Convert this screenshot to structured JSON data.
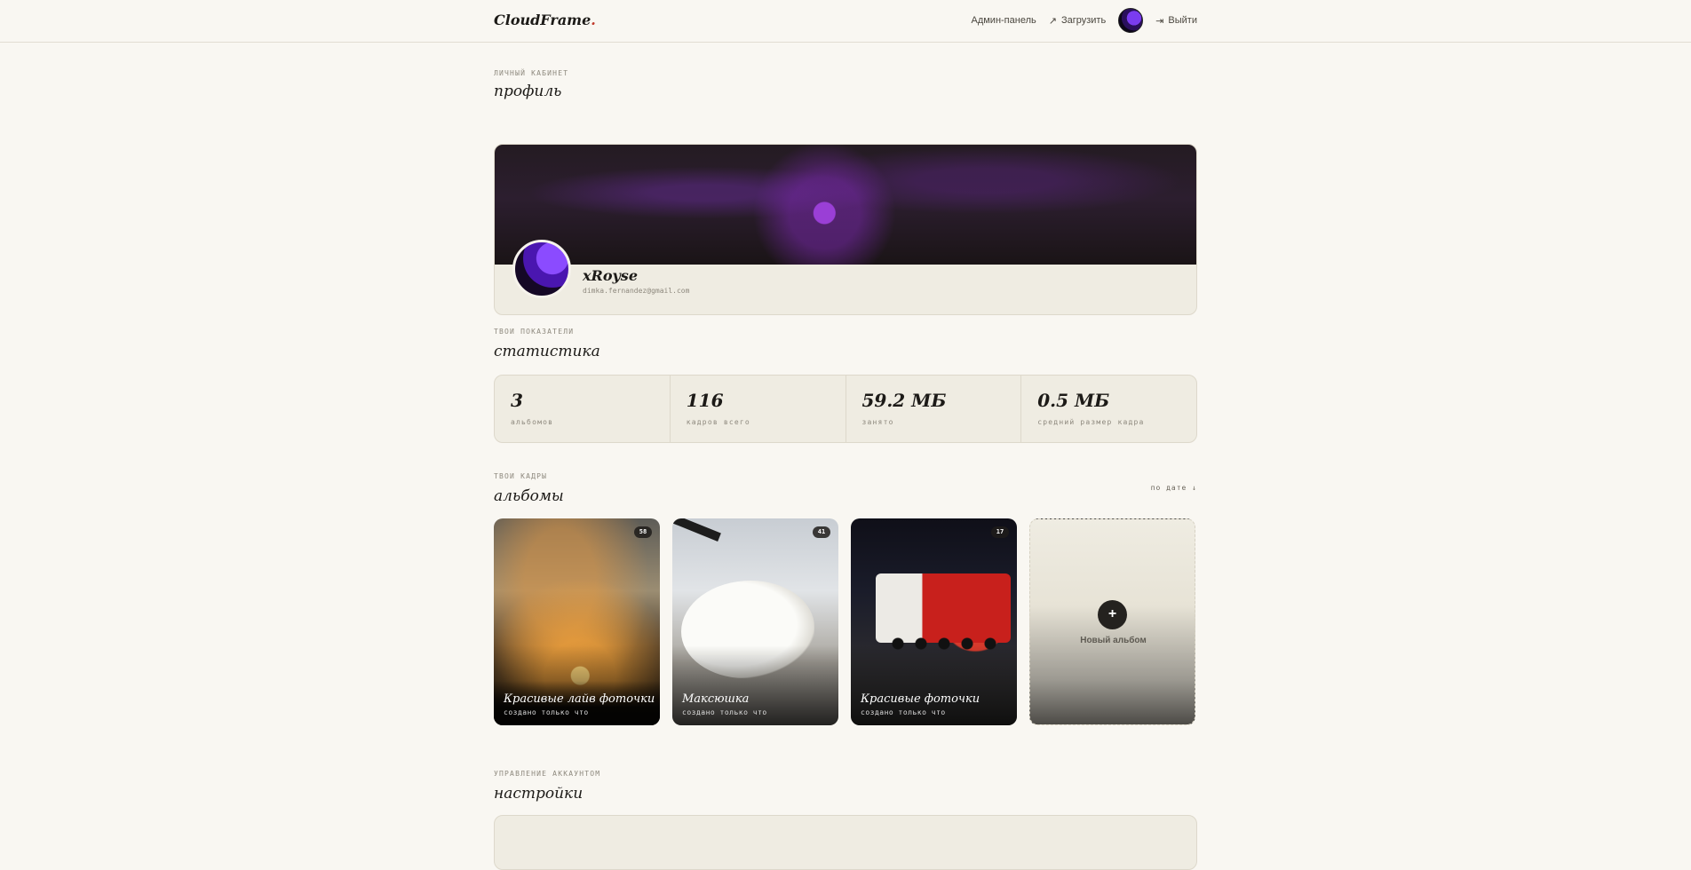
{
  "header": {
    "logo": "CloudFrame",
    "logo_dot": ".",
    "admin_label": "Админ-панель",
    "upload_label": "Загрузить",
    "logout_label": "Выйти"
  },
  "profile_section": {
    "eyebrow": "личный кабинет",
    "title": "профиль",
    "name": "xRoyse",
    "email": "dimka.fernandez@gmail.com"
  },
  "stats_section": {
    "eyebrow": "твои показатели",
    "title": "статистика",
    "items": [
      {
        "value": "3",
        "label": "альбомов"
      },
      {
        "value": "116",
        "label": "кадров всего"
      },
      {
        "value": "59.2 МБ",
        "label": "занято"
      },
      {
        "value": "0.5 МБ",
        "label": "средний размер кадра"
      }
    ]
  },
  "albums_section": {
    "eyebrow": "твои кадры",
    "title": "альбомы",
    "sort_label": "по дате ↓",
    "items": [
      {
        "title": "Красивые лайв фоточки",
        "subtitle": "создано только что",
        "count": "58"
      },
      {
        "title": "Максюшка",
        "subtitle": "создано только что",
        "count": "41"
      },
      {
        "title": "Красивые фоточки",
        "subtitle": "создано только что",
        "count": "17"
      }
    ],
    "new_album_label": "Новый альбом",
    "new_album_plus": "+"
  },
  "settings_section": {
    "eyebrow": "управление аккаунтом",
    "title": "настройки"
  },
  "icons": {
    "upload": "arrow-up-right-icon",
    "logout": "logout-icon"
  }
}
